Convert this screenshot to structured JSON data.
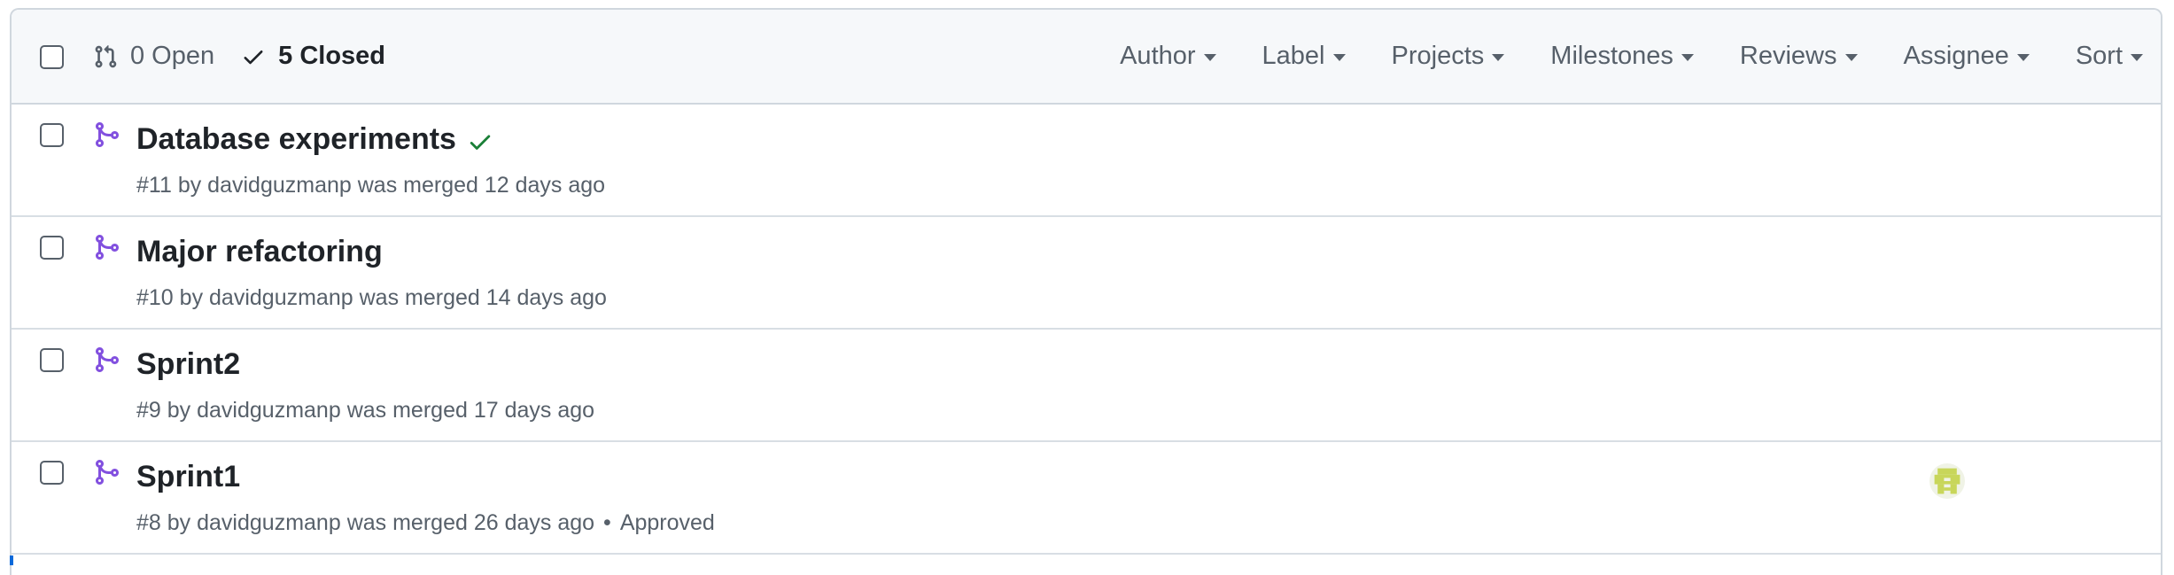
{
  "header": {
    "open_label": "0 Open",
    "closed_label": "5 Closed",
    "filters": [
      "Author",
      "Label",
      "Projects",
      "Milestones",
      "Reviews",
      "Assignee",
      "Sort"
    ]
  },
  "pull_requests": [
    {
      "title": "Database experiments",
      "number": "#11",
      "by": "by",
      "author": "davidguzmanp",
      "status": "was merged 12 days ago",
      "has_check": true
    },
    {
      "title": "Major refactoring",
      "number": "#10",
      "by": "by",
      "author": "davidguzmanp",
      "status": "was merged 14 days ago"
    },
    {
      "title": "Sprint2",
      "number": "#9",
      "by": "by",
      "author": "davidguzmanp",
      "status": "was merged 17 days ago"
    },
    {
      "title": "Sprint1",
      "number": "#8",
      "by": "by",
      "author": "davidguzmanp",
      "status": "was merged 26 days ago",
      "review": "Approved",
      "separator": "•",
      "has_assignee_avatar": true
    }
  ],
  "colors": {
    "merged_purple": "#8250df",
    "success_green": "#1a7f37",
    "muted": "#57606a",
    "header_bg": "#f6f8fa",
    "border": "#d0d7de",
    "avatar": "#c8d65a"
  },
  "icons": {
    "open_state": "git-pull-request-icon",
    "closed_state": "check-icon",
    "row": "git-merge-icon",
    "status": "check-icon",
    "assignee": "identicon-avatar"
  }
}
